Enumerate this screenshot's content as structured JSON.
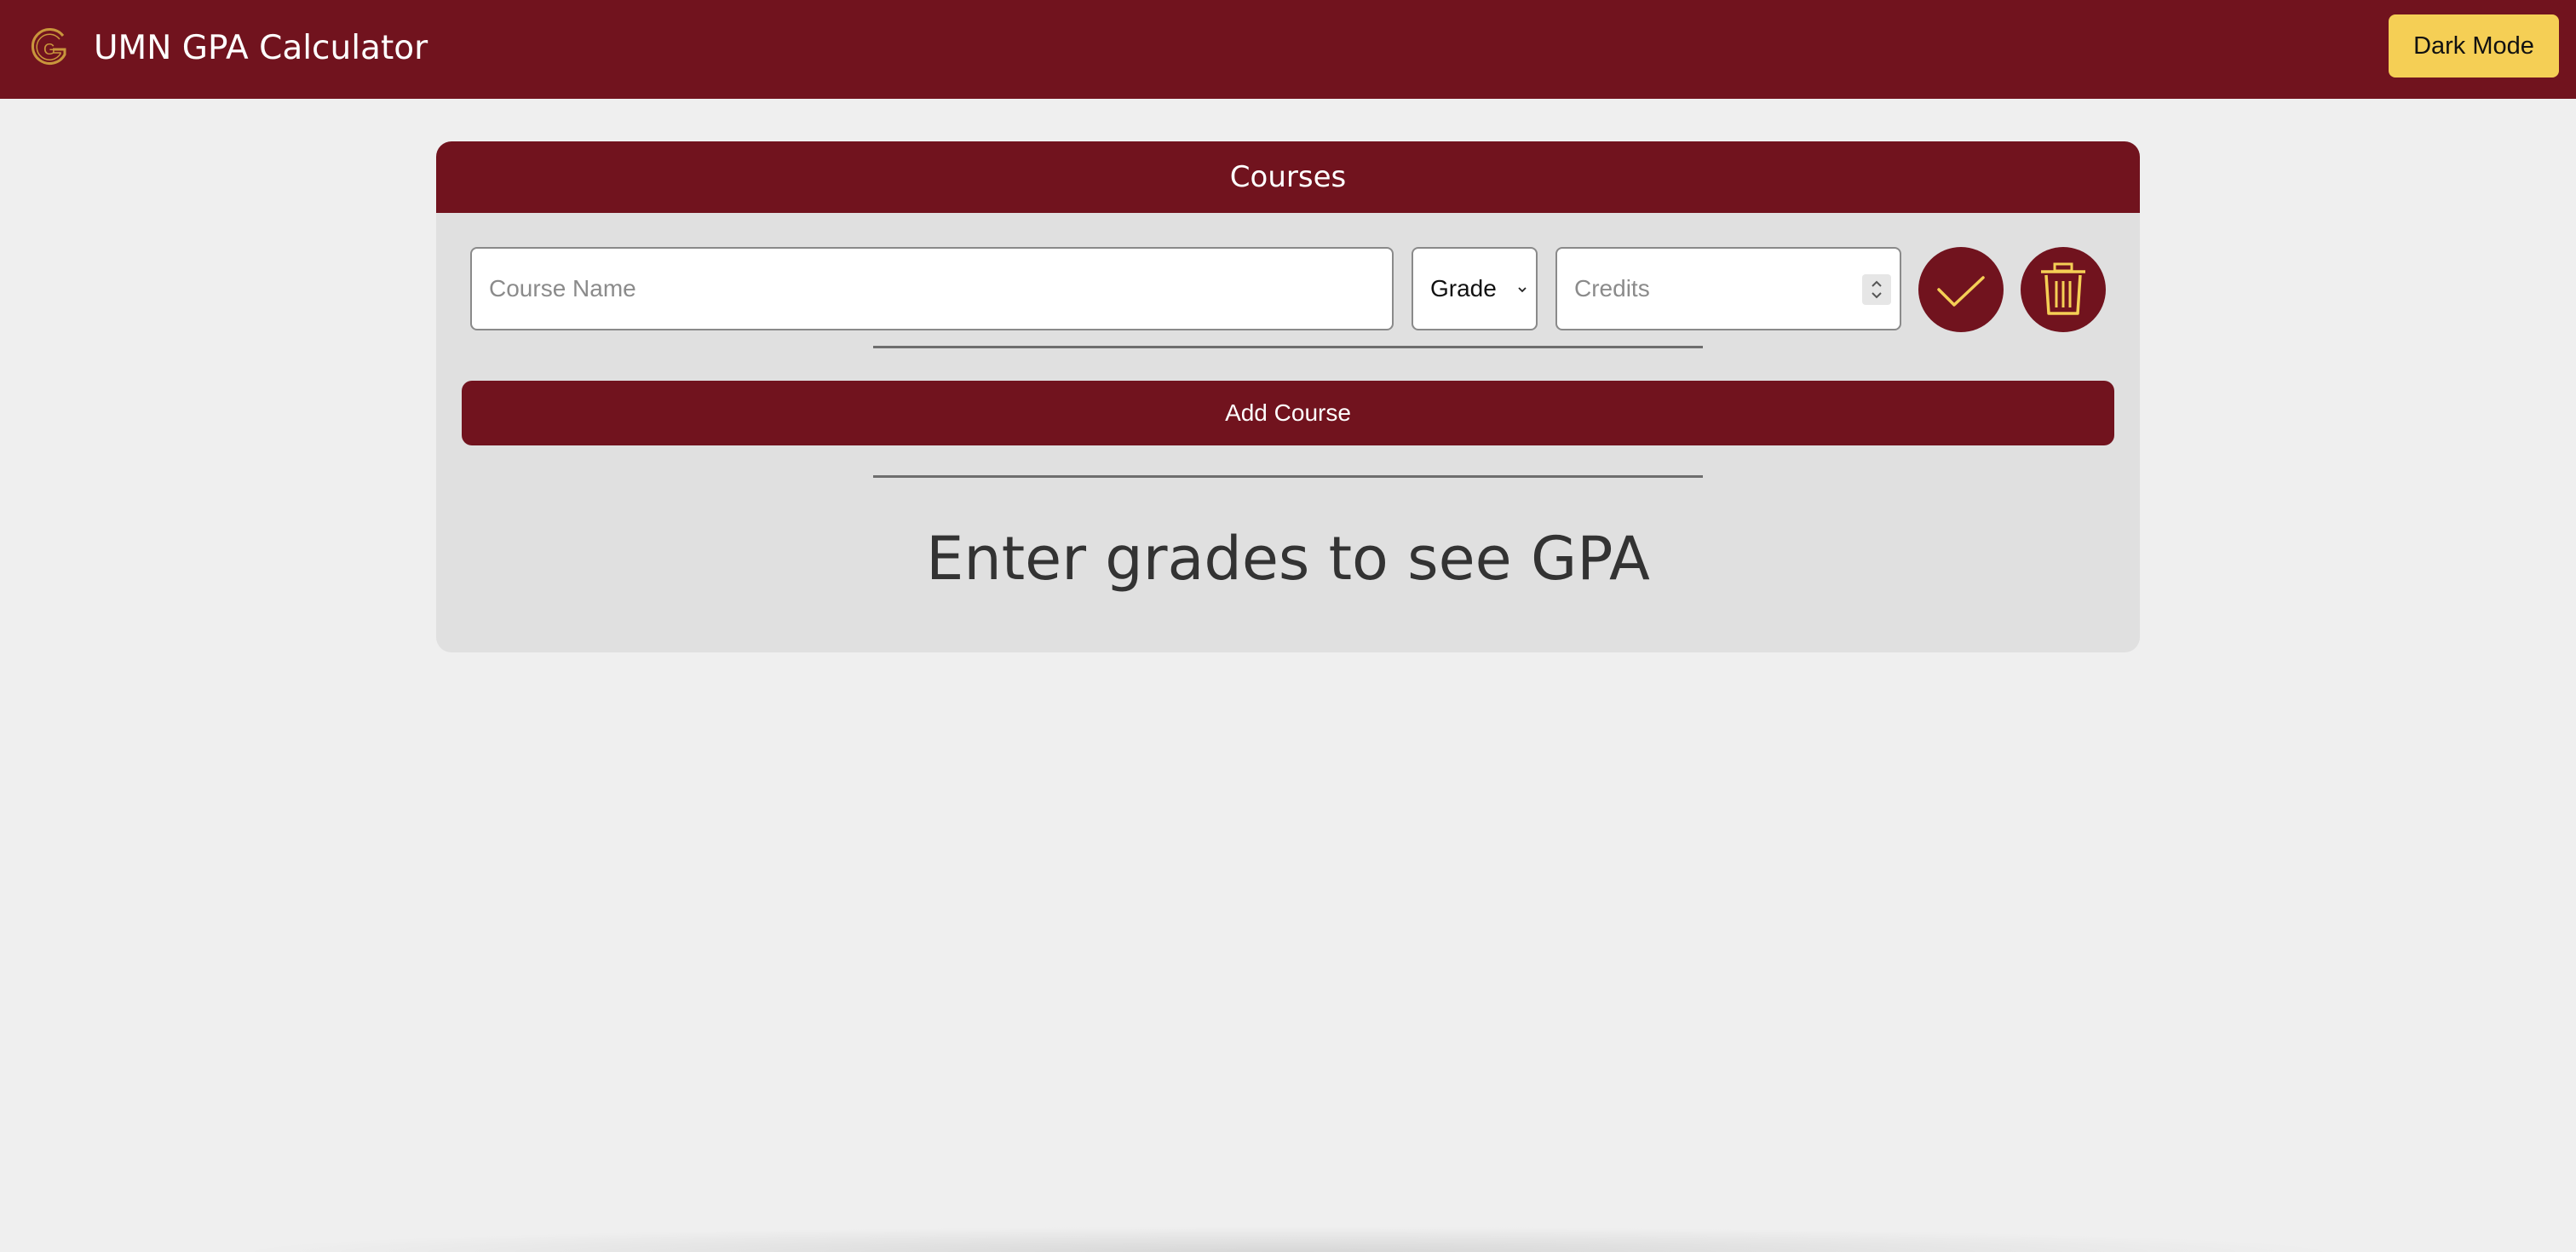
{
  "header": {
    "logo_letter": "G",
    "title": "UMN GPA Calculator",
    "dark_mode_label": "Dark Mode"
  },
  "courses_card": {
    "title": "Courses",
    "course_row": {
      "name_placeholder": "Course Name",
      "grade_selected": "Grade",
      "credits_placeholder": "Credits",
      "confirm_icon": "check-icon",
      "delete_icon": "trash-icon"
    },
    "add_course_label": "Add Course",
    "gpa_message": "Enter grades to see GPA"
  },
  "colors": {
    "maroon": "#71131e",
    "gold": "#f5cf55",
    "background": "#efefef",
    "card": "#e0e0e0"
  }
}
